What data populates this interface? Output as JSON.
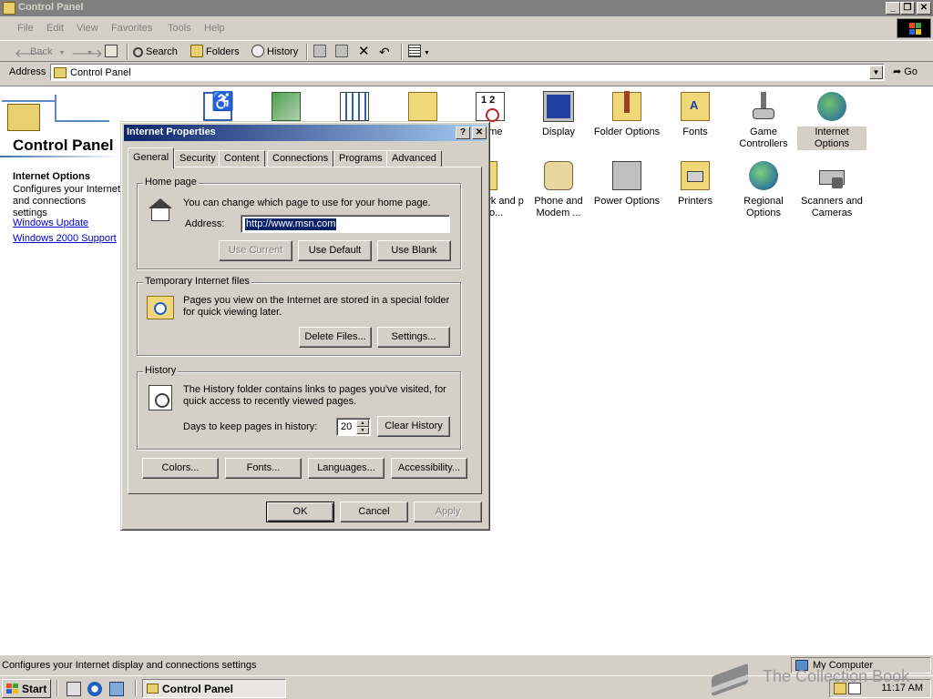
{
  "window": {
    "title": "Control Panel",
    "minimize_glyph": "_",
    "maximize_glyph": "❐",
    "close_glyph": "✕"
  },
  "menu": [
    "File",
    "Edit",
    "View",
    "Favorites",
    "Tools",
    "Help"
  ],
  "toolbar": {
    "back": "Back",
    "forward": "",
    "search": "Search",
    "folders": "Folders",
    "history": "History"
  },
  "address": {
    "label": "Address",
    "value": "Control Panel",
    "go": "Go"
  },
  "left_pane": {
    "title": "Control Panel",
    "heading": "Internet Options",
    "description": "Configures your Internet and connections settings",
    "links": [
      "Windows Update",
      "Windows 2000 Support"
    ]
  },
  "items_row1": [
    {
      "label": "",
      "icon": "accessibility-icon"
    },
    {
      "label": "",
      "icon": "add-remove-programs-icon"
    },
    {
      "label": "",
      "icon": "administrative-tools-icon"
    },
    {
      "label": "",
      "icon": "folder-icon"
    },
    {
      "label": "/Time",
      "icon": "date-time-icon"
    },
    {
      "label": "Display",
      "icon": "display-icon"
    },
    {
      "label": "Folder Options",
      "icon": "folder-options-icon"
    },
    {
      "label": "Fonts",
      "icon": "fonts-icon"
    },
    {
      "label": "Game Controllers",
      "icon": "game-controllers-icon"
    },
    {
      "label": "Internet Options",
      "icon": "internet-options-icon",
      "selected": true
    }
  ],
  "items_row2": [
    {
      "label": "ork and p Co...",
      "icon": "network-icon"
    },
    {
      "label": "Phone and Modem ...",
      "icon": "phone-modem-icon"
    },
    {
      "label": "Power Options",
      "icon": "power-options-icon"
    },
    {
      "label": "Printers",
      "icon": "printers-icon"
    },
    {
      "label": "Regional Options",
      "icon": "regional-options-icon"
    },
    {
      "label": "Scanners and Cameras",
      "icon": "scanners-cameras-icon"
    }
  ],
  "status": {
    "text": "Configures your Internet display and connections settings",
    "zone": "My Computer"
  },
  "taskbar": {
    "start": "Start",
    "task": "Control Panel",
    "clock": "11:17 AM"
  },
  "watermark": "The Collection Book",
  "dialog": {
    "title": "Internet Properties",
    "help_glyph": "?",
    "close_glyph": "✕",
    "tabs": [
      "General",
      "Security",
      "Content",
      "Connections",
      "Programs",
      "Advanced"
    ],
    "home": {
      "legend": "Home page",
      "desc": "You can change which page to use for your home page.",
      "address_label": "Address:",
      "address_value": "http://www.msn.com",
      "use_current": "Use Current",
      "use_default": "Use Default",
      "use_blank": "Use Blank"
    },
    "temp": {
      "legend": "Temporary Internet files",
      "desc": "Pages you view on the Internet are stored in a special folder for quick viewing later.",
      "delete_files": "Delete Files...",
      "settings": "Settings..."
    },
    "history": {
      "legend": "History",
      "desc": "The History folder contains links to pages you've visited, for quick access to recently viewed pages.",
      "days_label": "Days to keep pages in history:",
      "days_value": "20",
      "clear": "Clear History"
    },
    "bottom_buttons": {
      "colors": "Colors...",
      "fonts": "Fonts...",
      "languages": "Languages...",
      "accessibility": "Accessibility..."
    },
    "ok": "OK",
    "cancel": "Cancel",
    "apply": "Apply"
  }
}
